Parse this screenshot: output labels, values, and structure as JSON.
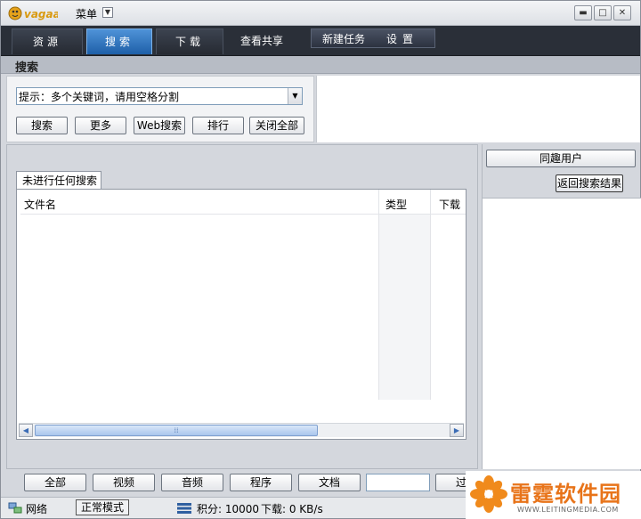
{
  "app": {
    "logo_text": "vagaa",
    "menu_label": "菜单"
  },
  "tabs": [
    {
      "label": "资源"
    },
    {
      "label": "搜索"
    },
    {
      "label": "下载"
    },
    {
      "label": "查看共享"
    },
    {
      "label": "新建任务"
    },
    {
      "label": "设置"
    }
  ],
  "section": {
    "title": "搜索"
  },
  "search": {
    "value": "提示：多个关键词，请用空格分割",
    "buttons": [
      "搜索",
      "更多",
      "Web搜索",
      "排行",
      "关闭全部"
    ]
  },
  "results": {
    "tab_label": "未进行任何搜索",
    "columns": [
      "文件名",
      "类型",
      "下载"
    ]
  },
  "right_panel": {
    "peers_button": "同趣用户",
    "back_button": "返回搜索结果"
  },
  "filters": [
    "全部",
    "视频",
    "音频",
    "程序",
    "文档",
    "过"
  ],
  "status": {
    "network": "网络",
    "mode": "正常模式",
    "points_label": "积分: 10000",
    "download_label": "下载: 0 KB/s"
  },
  "watermark": {
    "name": "雷霆软件园",
    "url": "WWW.LEITINGMEDIA.COM"
  },
  "colors": {
    "accent": "#2f74c0",
    "tabbar": "#2a2f38",
    "watermark": "#e8741a"
  }
}
